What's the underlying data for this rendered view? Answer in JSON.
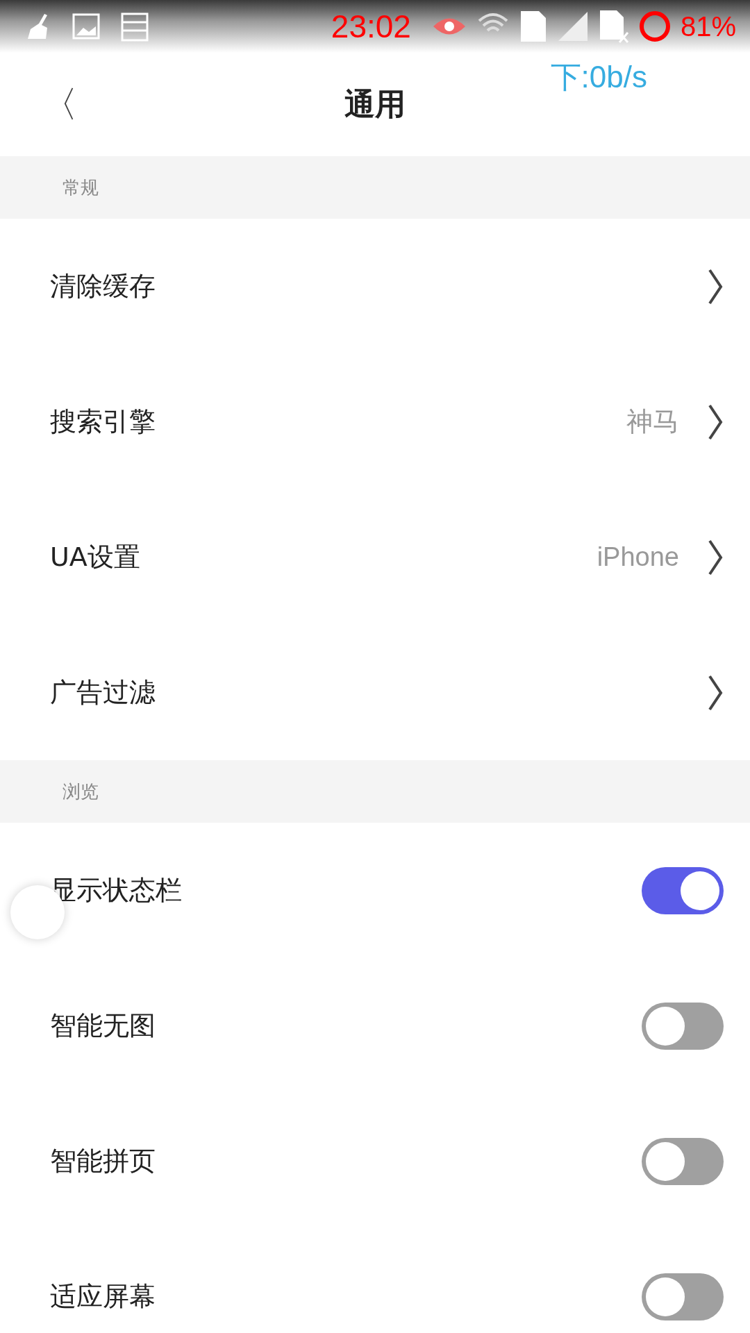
{
  "status_bar": {
    "time": "23:02",
    "battery": "81%",
    "net_speed": "下:0b/s"
  },
  "header": {
    "back": "〈",
    "title": "通用"
  },
  "sections": [
    {
      "title": "常规",
      "items": [
        {
          "kind": "link",
          "label": "清除缓存"
        },
        {
          "kind": "link",
          "label": "搜索引擎",
          "value": "神马"
        },
        {
          "kind": "link",
          "label": "UA设置",
          "value": "iPhone"
        },
        {
          "kind": "link",
          "label": "广告过滤"
        }
      ]
    },
    {
      "title": "浏览",
      "items": [
        {
          "kind": "toggle",
          "label": "显示状态栏",
          "on": true
        },
        {
          "kind": "toggle",
          "label": "智能无图",
          "on": false
        },
        {
          "kind": "toggle",
          "label": "智能拼页",
          "on": false
        },
        {
          "kind": "toggle",
          "label": "适应屏幕",
          "on": false
        }
      ]
    }
  ]
}
